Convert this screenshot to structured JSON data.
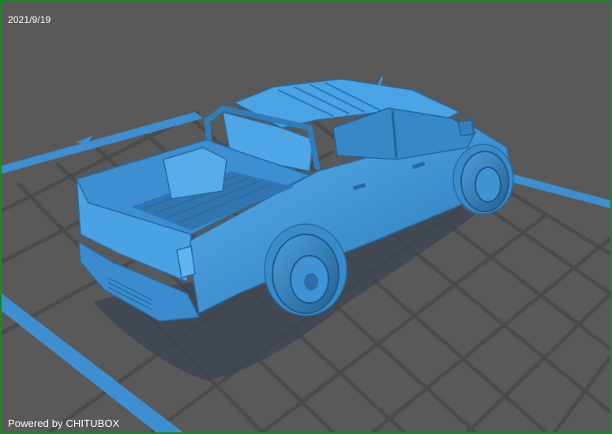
{
  "viewer": {
    "date": "2021/9/19",
    "watermark": "Powered by CHITUBOX"
  },
  "colors": {
    "background": "#595959",
    "grid_line": "#4a4a4a",
    "plate_edge": "#3d8fd1",
    "model_body": "#3f93d3",
    "model_shadow": "#2f3a44",
    "frame": "#1c8a1c"
  },
  "icons": {
    "model": "pickup-truck-3d-model"
  }
}
